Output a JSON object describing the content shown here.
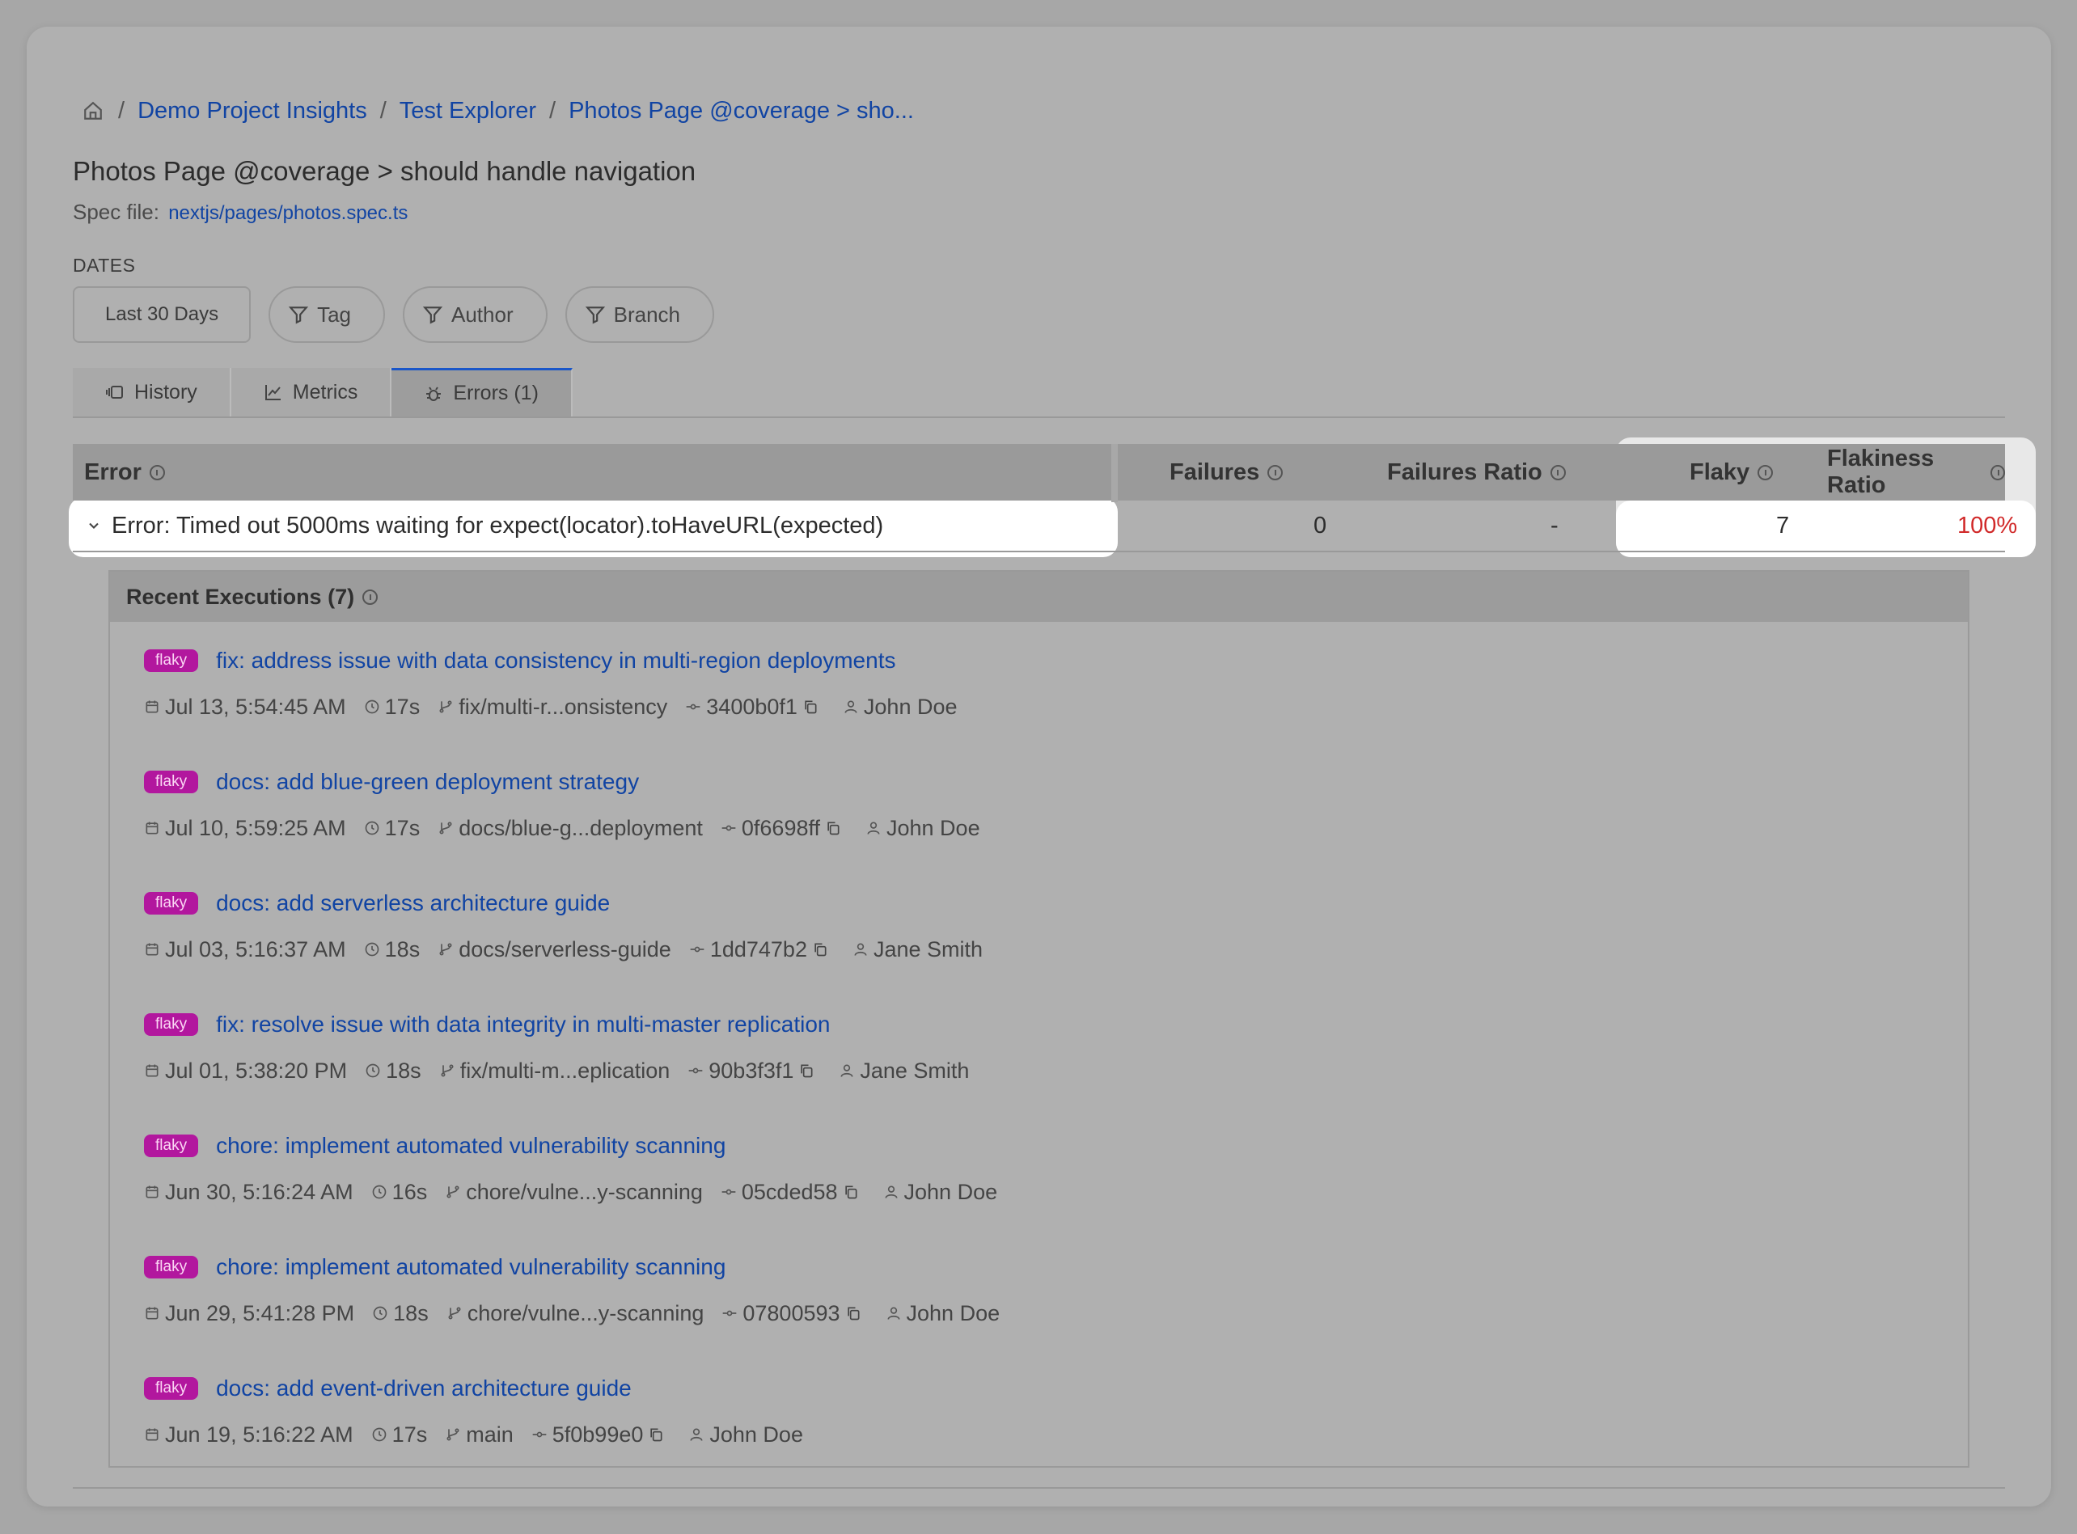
{
  "breadcrumbs": {
    "home_icon": "home-icon",
    "sep": "/",
    "items": [
      "Demo Project Insights",
      "Test Explorer",
      "Photos Page @coverage > sho..."
    ]
  },
  "page": {
    "title": "Photos Page @coverage > should handle navigation",
    "spec_label": "Spec file:",
    "spec_link": "nextjs/pages/photos.spec.ts"
  },
  "filters": {
    "dates_label": "DATES",
    "dates_value": "Last 30 Days",
    "tag": "Tag",
    "author": "Author",
    "branch": "Branch"
  },
  "tabs": [
    {
      "label": "History",
      "icon": "history-icon"
    },
    {
      "label": "Metrics",
      "icon": "chart-line-icon"
    },
    {
      "label": "Errors (1)",
      "icon": "bug-icon",
      "active": true
    }
  ],
  "table": {
    "headers": {
      "error": "Error",
      "failures": "Failures",
      "failures_ratio": "Failures Ratio",
      "flaky": "Flaky",
      "flakiness_ratio": "Flakiness Ratio"
    },
    "row": {
      "error": "Error: Timed out 5000ms waiting for expect(locator).toHaveURL(expected)",
      "failures": "0",
      "failures_ratio": "-",
      "flaky": "7",
      "flakiness_ratio": "100%"
    }
  },
  "recent": {
    "title": "Recent Executions (7)",
    "items": [
      {
        "badge": "flaky",
        "title": "fix: address issue with data consistency in multi-region deployments",
        "date": "Jul 13, 5:54:45 AM",
        "duration": "17s",
        "branch": "fix/multi-r...onsistency",
        "commit": "3400b0f1",
        "author": "John Doe"
      },
      {
        "badge": "flaky",
        "title": "docs: add blue-green deployment strategy",
        "date": "Jul 10, 5:59:25 AM",
        "duration": "17s",
        "branch": "docs/blue-g...deployment",
        "commit": "0f6698ff",
        "author": "John Doe"
      },
      {
        "badge": "flaky",
        "title": "docs: add serverless architecture guide",
        "date": "Jul 03, 5:16:37 AM",
        "duration": "18s",
        "branch": "docs/serverless-guide",
        "commit": "1dd747b2",
        "author": "Jane Smith"
      },
      {
        "badge": "flaky",
        "title": "fix: resolve issue with data integrity in multi-master replication",
        "date": "Jul 01, 5:38:20 PM",
        "duration": "18s",
        "branch": "fix/multi-m...eplication",
        "commit": "90b3f3f1",
        "author": "Jane Smith"
      },
      {
        "badge": "flaky",
        "title": "chore: implement automated vulnerability scanning",
        "date": "Jun 30, 5:16:24 AM",
        "duration": "16s",
        "branch": "chore/vulne...y-scanning",
        "commit": "05cded58",
        "author": "John Doe"
      },
      {
        "badge": "flaky",
        "title": "chore: implement automated vulnerability scanning",
        "date": "Jun 29, 5:41:28 PM",
        "duration": "18s",
        "branch": "chore/vulne...y-scanning",
        "commit": "07800593",
        "author": "John Doe"
      },
      {
        "badge": "flaky",
        "title": "docs: add event-driven architecture guide",
        "date": "Jun 19, 5:16:22 AM",
        "duration": "17s",
        "branch": "main",
        "commit": "5f0b99e0",
        "author": "John Doe"
      }
    ]
  },
  "colors": {
    "link": "#1144a3",
    "badge_bg": "#b2179e",
    "ratio_red": "#d12a2a",
    "active_tab_accent": "#1a56c8"
  }
}
